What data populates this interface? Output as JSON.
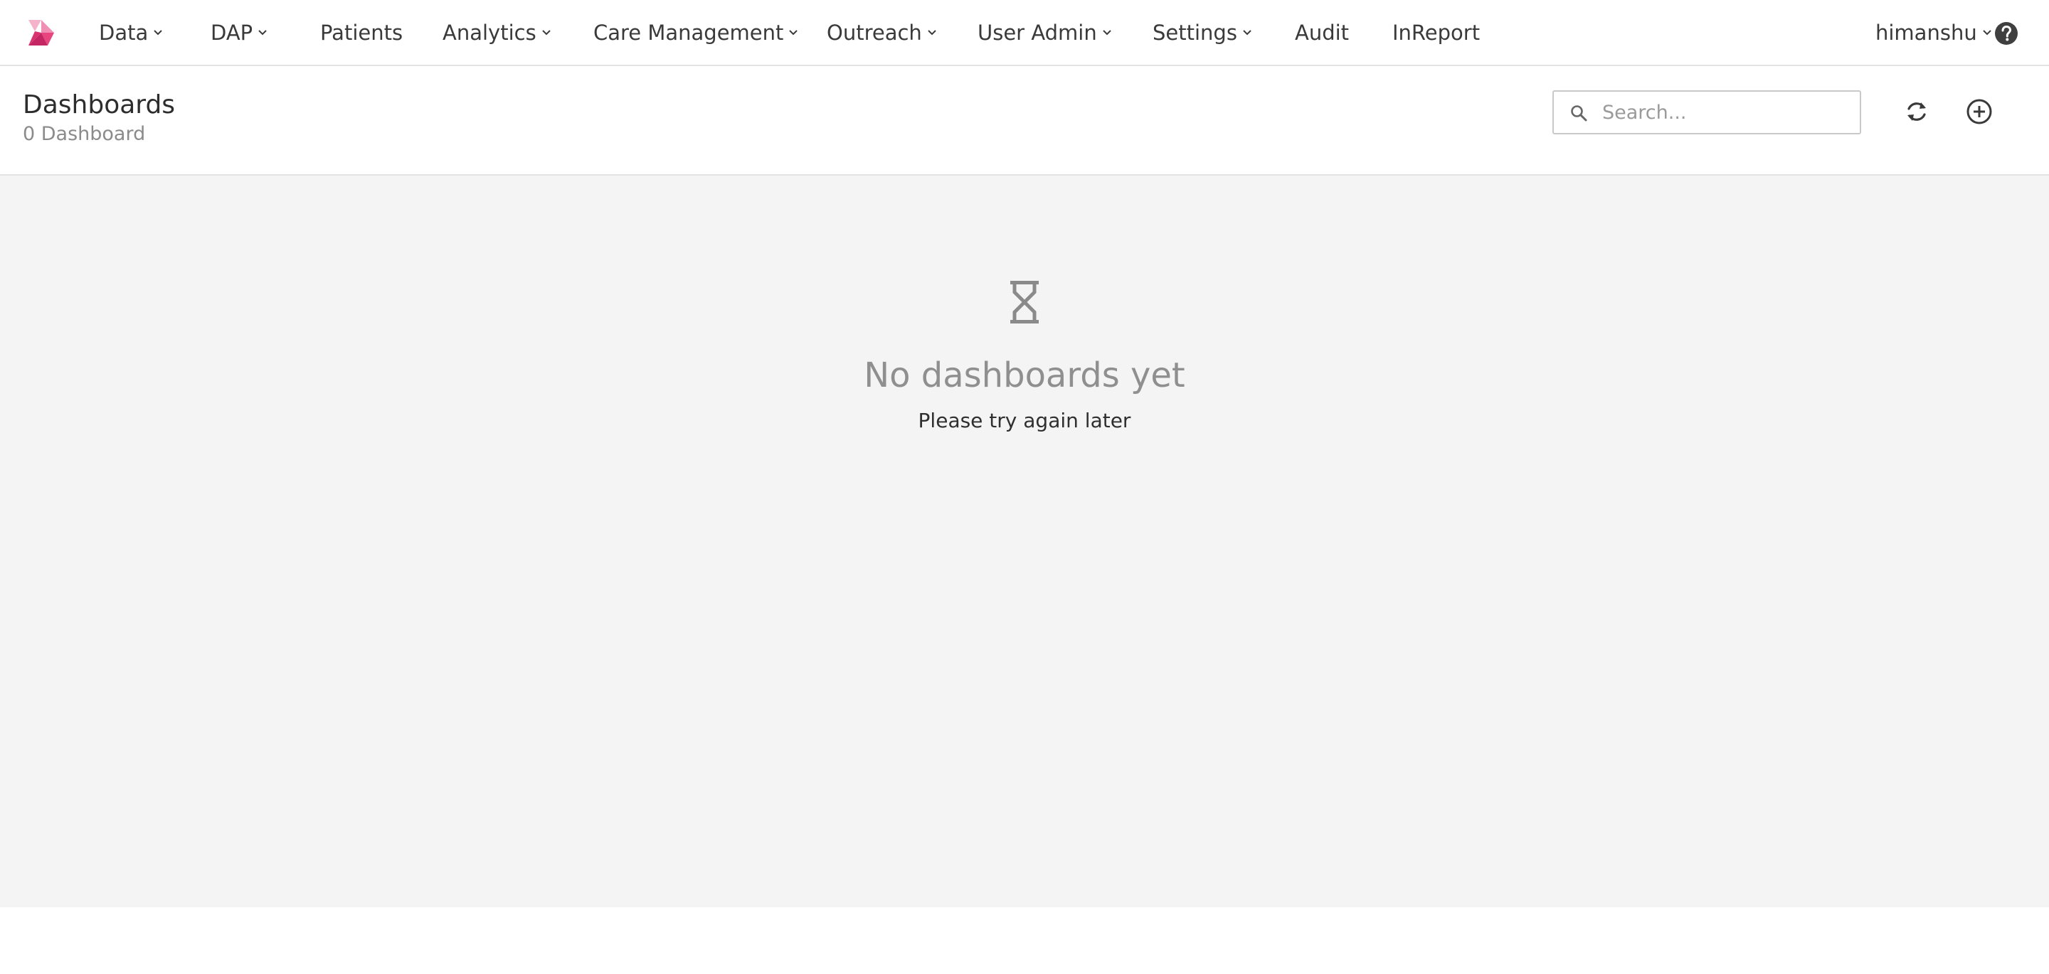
{
  "nav": {
    "items": [
      {
        "label": "Data",
        "dropdown": true
      },
      {
        "label": "DAP",
        "dropdown": true
      },
      {
        "label": "Patients",
        "dropdown": false
      },
      {
        "label": "Analytics",
        "dropdown": true
      },
      {
        "label": "Care Management",
        "dropdown": true
      },
      {
        "label": "Outreach",
        "dropdown": true
      },
      {
        "label": "User Admin",
        "dropdown": true
      },
      {
        "label": "Settings",
        "dropdown": true
      },
      {
        "label": "Audit",
        "dropdown": false
      },
      {
        "label": "InReport",
        "dropdown": false
      }
    ],
    "user": {
      "name": "himanshu",
      "dropdown": true
    },
    "icons": {
      "logo": "brand-logo",
      "help": "help-icon"
    }
  },
  "header": {
    "title": "Dashboards",
    "subtitle": "0 Dashboard",
    "search": {
      "placeholder": "Search...",
      "value": ""
    },
    "actions": {
      "refresh": "refresh-icon",
      "add": "add-circle-icon"
    }
  },
  "empty_state": {
    "icon": "hourglass-icon",
    "title": "No dashboards yet",
    "message": "Please try again later"
  },
  "colors": {
    "brand_pink": "#e8457f",
    "brand_light_pink": "#f5b3cb",
    "content_bg": "#f4f4f4",
    "muted_text": "#8f8f8f"
  }
}
